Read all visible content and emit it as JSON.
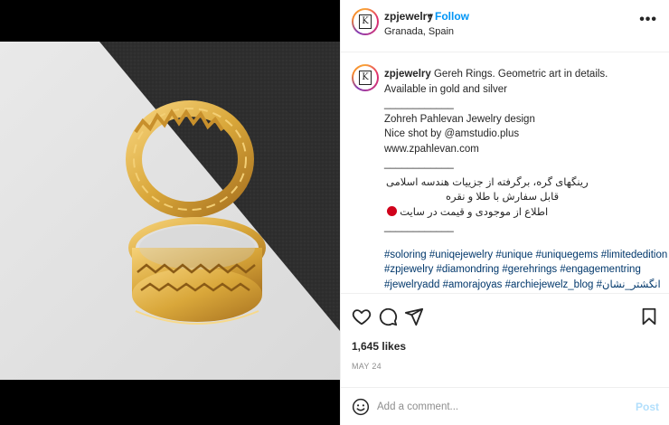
{
  "post": {
    "username": "zpjewelry",
    "follow_label": "Follow",
    "separator": "•",
    "location": "Granada, Spain",
    "more_label": "•••",
    "avatar_logo_letter": "K"
  },
  "caption": {
    "username": "zpjewelry",
    "lines": [
      "Gereh Rings. Geometric art in details.",
      "Available in gold and silver",
      "____________",
      "Zohreh Pahlevan Jewelry design",
      "Nice shot by @amstudio.plus",
      "www.zpahlevan.com",
      "____________"
    ],
    "persian_lines": [
      "رینگهای گره، برگرفته از جزییات هندسه اسلامی",
      "قابل سفارش با طلا و نقره",
      "اطلاع از موجودی و قیمت در سایت"
    ],
    "divider_bottom": "____________",
    "hashtags": [
      "#soloring #uniqejewelry #unique #uniquegems #limitededition",
      "#zpjewelry #diamondring #gerehrings #engagementring",
      "#jewelryadd #amorajoyas #archiejewelz_blog #انگشتر_نشان"
    ]
  },
  "actions": {
    "like_icon": "heart-icon",
    "comment_icon": "comment-icon",
    "share_icon": "paper-plane-icon",
    "save_icon": "bookmark-icon"
  },
  "likes_text": "1,645 likes",
  "date_text": "MAY 24",
  "comment": {
    "placeholder": "Add a comment...",
    "post_label": "Post",
    "emoji_icon": "smiley-icon"
  },
  "colors": {
    "follow": "#0095f6",
    "post_disabled": "#b2dffc",
    "hashtag": "#00376b",
    "gold": "#d9a73a"
  }
}
